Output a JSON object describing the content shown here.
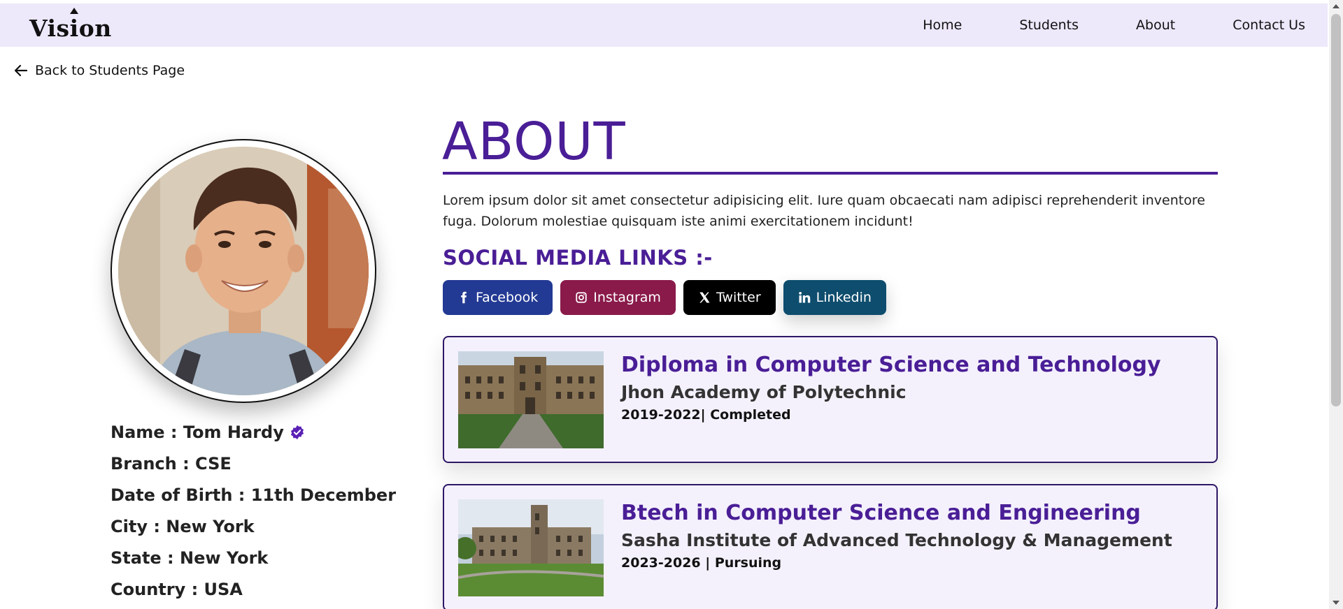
{
  "nav": {
    "logo": "Vision",
    "links": [
      "Home",
      "Students",
      "About",
      "Contact Us"
    ]
  },
  "back_link": {
    "label": "Back to Students Page",
    "icon": "arrow-left-icon"
  },
  "profile": {
    "name_label": "Name : Tom Hardy",
    "verified_icon": "verified-badge-icon",
    "branch": "Branch : CSE",
    "dob": "Date of Birth : 11th December",
    "city": "City : New York",
    "state": "State : New York",
    "country": "Country : USA"
  },
  "about": {
    "title": "ABOUT",
    "text": "Lorem ipsum dolor sit amet consectetur adipisicing elit. Iure quam obcaecati nam adipisci reprehenderit inventore fuga. Dolorum molestiae quisquam iste animi exercitationem incidunt!"
  },
  "social": {
    "title": "SOCIAL MEDIA LINKS :-",
    "links": [
      {
        "label": "Facebook",
        "icon": "facebook-icon",
        "color": "#233a94"
      },
      {
        "label": "Instagram",
        "icon": "instagram-icon",
        "color": "#8a1a4a"
      },
      {
        "label": "Twitter",
        "icon": "x-twitter-icon",
        "color": "#000000"
      },
      {
        "label": "Linkedin",
        "icon": "linkedin-icon",
        "color": "#0e4d6e"
      }
    ]
  },
  "education": [
    {
      "degree": "Diploma in Computer Science and Technology",
      "institute": "Jhon Academy of Polytechnic",
      "meta": "2019-2022| Completed"
    },
    {
      "degree": "Btech in Computer Science and Engineering",
      "institute": "Sasha Institute of Advanced Technology & Management",
      "meta": "2023-2026 | Pursuing"
    }
  ],
  "colors": {
    "accent": "#4a1e96",
    "nav_bg": "#eee8fb",
    "card_bg": "#f4f1fd"
  }
}
